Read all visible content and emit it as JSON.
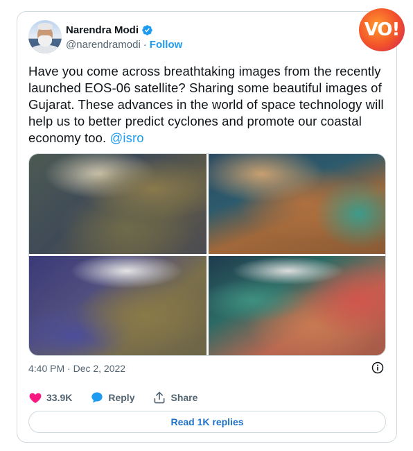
{
  "author": {
    "name": "Narendra Modi",
    "handle": "@narendramodi",
    "separator": "·",
    "follow_label": "Follow"
  },
  "brand_logo": {
    "text": "VO!"
  },
  "tweet": {
    "text": "Have you come across breathtaking images from the recently launched EOS-06 satellite? Sharing some beautiful images of Gujarat. These advances in the world of space technology will help us to better predict cyclones and promote our coastal economy too.",
    "mention": "@isro"
  },
  "media": {
    "images": [
      "satellite-image-1",
      "satellite-image-2",
      "satellite-image-3",
      "satellite-image-4"
    ]
  },
  "meta": {
    "timestamp": "4:40 PM · Dec 2, 2022"
  },
  "actions": {
    "like_count": "33.9K",
    "reply_label": "Reply",
    "share_label": "Share"
  },
  "replies_button": {
    "label": "Read 1K replies"
  },
  "colors": {
    "accent": "#1d9bf0",
    "like": "#f91880",
    "text": "#0f1419",
    "secondary": "#536471",
    "border": "#cfd9de"
  }
}
